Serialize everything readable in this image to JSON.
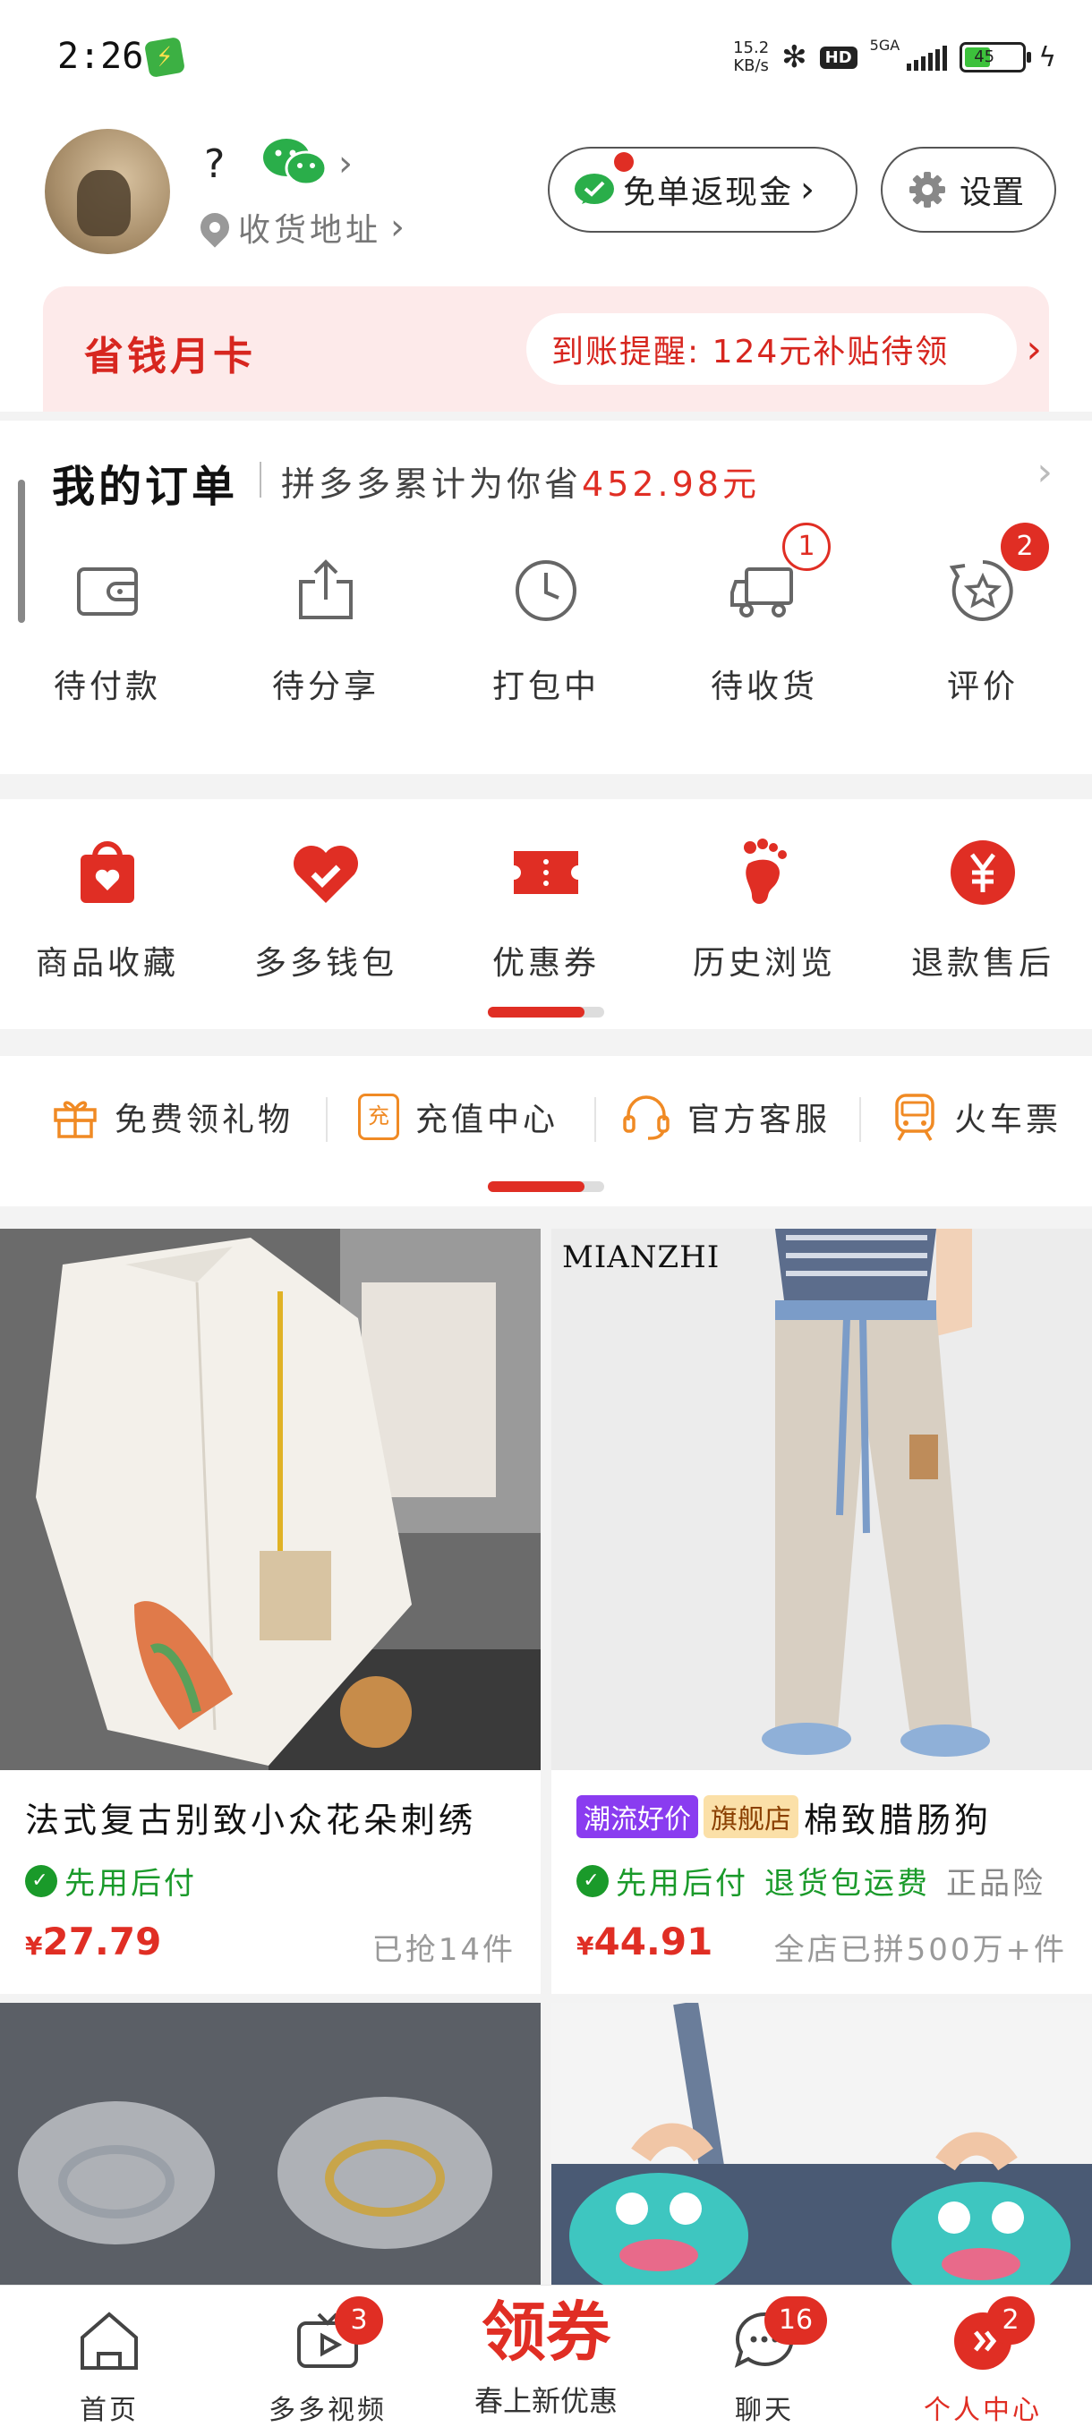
{
  "status_bar": {
    "time": "2:26",
    "net_speed_value": "15.2",
    "net_speed_unit": "KB/s",
    "hd": "HD",
    "network": "5GA",
    "battery": "45"
  },
  "profile": {
    "nickname": "?",
    "address_label": "收货地址",
    "cashback_label": "免单返现金",
    "settings_label": "设置"
  },
  "month_card": {
    "title": "省钱月卡",
    "notice": "到账提醒: 124元补贴待领"
  },
  "orders": {
    "title": "我的订单",
    "subtitle": "拼多多累计为你省",
    "saved_amount": "452.98元",
    "items": [
      {
        "label": "待付款",
        "icon": "wallet-icon"
      },
      {
        "label": "待分享",
        "icon": "share-icon"
      },
      {
        "label": "打包中",
        "icon": "clock-icon"
      },
      {
        "label": "待收货",
        "icon": "truck-icon",
        "badge": "1"
      },
      {
        "label": "评价",
        "icon": "review-icon",
        "badge": "2"
      }
    ]
  },
  "tools": [
    {
      "label": "商品收藏",
      "icon": "bag-heart-icon"
    },
    {
      "label": "多多钱包",
      "icon": "wallet-heart-icon"
    },
    {
      "label": "优惠券",
      "icon": "ticket-icon"
    },
    {
      "label": "历史浏览",
      "icon": "footprint-icon"
    },
    {
      "label": "退款售后",
      "icon": "yuan-icon"
    }
  ],
  "services": [
    {
      "label": "免费领礼物",
      "icon": "gift-icon"
    },
    {
      "label": "充值中心",
      "icon": "recharge-icon",
      "icon_text": "充"
    },
    {
      "label": "官方客服",
      "icon": "headset-icon"
    },
    {
      "label": "火车票",
      "icon": "train-icon"
    }
  ],
  "products": [
    {
      "title": "法式复古别致小众花朵刺绣",
      "features": [
        "先用后付"
      ],
      "price_symbol": "¥",
      "price": "27.79",
      "sold": "已抢14件"
    },
    {
      "brand_text": "MIANZHI",
      "tag_trend": "潮流好价",
      "tag_flagship": "旗舰店",
      "title": "棉致腊肠狗",
      "features": [
        "先用后付",
        "退货包运费",
        "正品险"
      ],
      "price_symbol": "¥",
      "price": "44.91",
      "sold": "全店已拼500万+件"
    }
  ],
  "tabbar": {
    "home": "首页",
    "video": "多多视频",
    "video_badge": "3",
    "coupon_big": "领券",
    "coupon_sub": "春上新优惠",
    "chat": "聊天",
    "chat_badge": "16",
    "me": "个人中心",
    "me_badge": "2"
  },
  "colors": {
    "accent": "#e02e24",
    "wechat_green": "#2aae4a",
    "feature_green": "#1a9a2a"
  }
}
